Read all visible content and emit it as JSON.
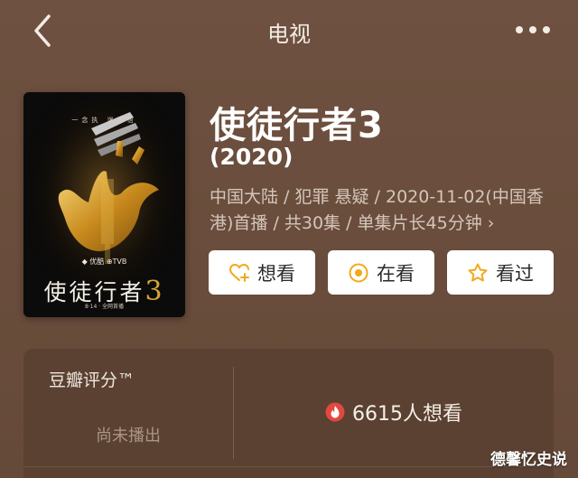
{
  "nav": {
    "title": "电视",
    "back_icon": "chevron-left-icon",
    "more_icon": "more-dots-icon"
  },
  "poster": {
    "top_text": "一念执  迷不悟",
    "title_text": "使徒行者",
    "title_num": "3",
    "logos_text": "◆ 优酷  ⊕TVB",
    "sub_text": "8·14 · 全网首播"
  },
  "show": {
    "title": "使徒行者3",
    "year": "(2020)",
    "meta": "中国大陆 / 犯罪 悬疑 / 2020-11-02(中国香港)首播 / 共30集 / 单集片长45分钟",
    "meta_chevron": "›"
  },
  "actions": {
    "want": {
      "label": "想看",
      "icon": "heart-plus-icon"
    },
    "watching": {
      "label": "在看",
      "icon": "target-icon"
    },
    "watched": {
      "label": "看过",
      "icon": "star-icon"
    }
  },
  "rating": {
    "label": "豆瓣评分™",
    "status": "尚未播出",
    "wish_count": "6615人想看",
    "wish_icon": "flame-icon"
  },
  "watermark": "德馨忆史说",
  "colors": {
    "background": "#6b4e3c",
    "card": "#5b4131",
    "accent": "#f2a91a",
    "flame": "#e2483f"
  }
}
